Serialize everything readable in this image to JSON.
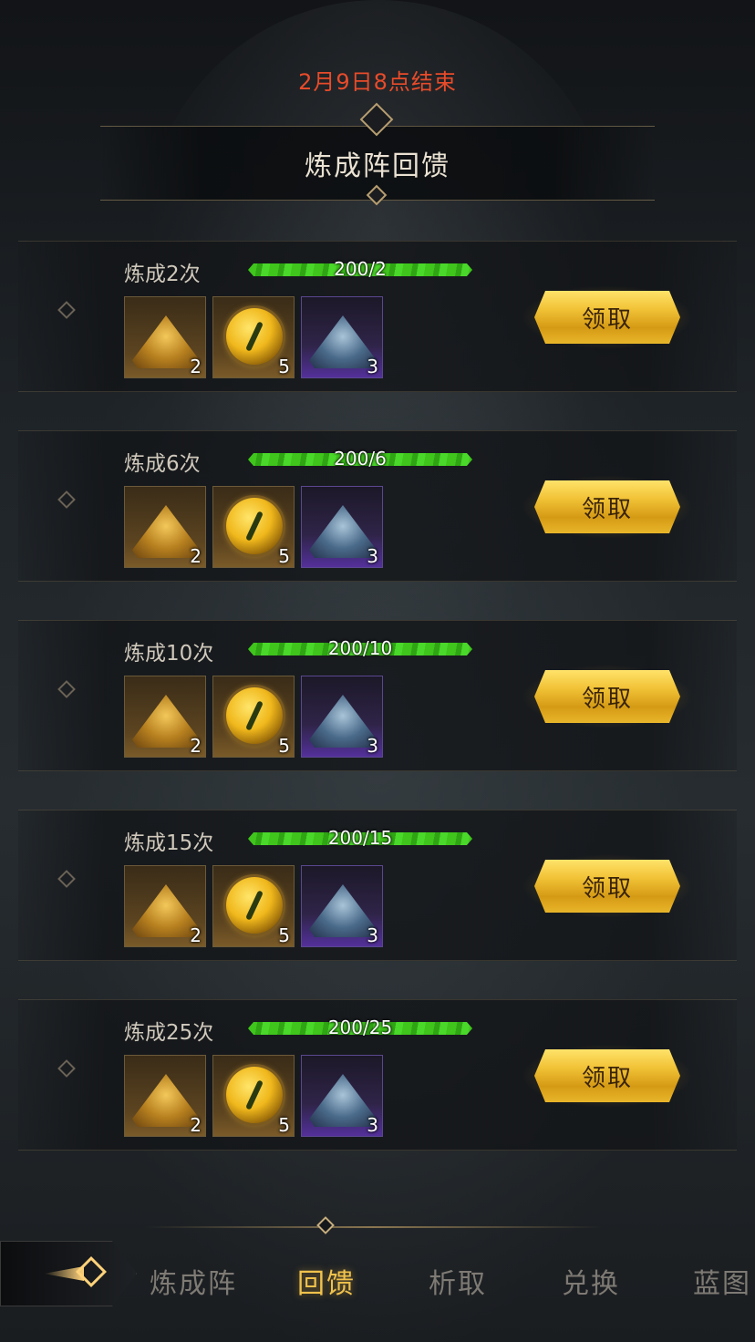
{
  "deadline": "2月9日8点结束",
  "title": "炼成阵回馈",
  "rows": [
    {
      "label": "炼成2次",
      "progress": "200/2",
      "claim": "领取",
      "items": [
        {
          "count": "2"
        },
        {
          "count": "5"
        },
        {
          "count": "3"
        }
      ]
    },
    {
      "label": "炼成6次",
      "progress": "200/6",
      "claim": "领取",
      "items": [
        {
          "count": "2"
        },
        {
          "count": "5"
        },
        {
          "count": "3"
        }
      ]
    },
    {
      "label": "炼成10次",
      "progress": "200/10",
      "claim": "领取",
      "items": [
        {
          "count": "2"
        },
        {
          "count": "5"
        },
        {
          "count": "3"
        }
      ]
    },
    {
      "label": "炼成15次",
      "progress": "200/15",
      "claim": "领取",
      "items": [
        {
          "count": "2"
        },
        {
          "count": "5"
        },
        {
          "count": "3"
        }
      ]
    },
    {
      "label": "炼成25次",
      "progress": "200/25",
      "claim": "领取",
      "items": [
        {
          "count": "2"
        },
        {
          "count": "5"
        },
        {
          "count": "3"
        }
      ]
    }
  ],
  "item_icons": [
    "gold-dust-pile-icon",
    "golden-orb-icon",
    "blue-crystal-pile-icon"
  ],
  "tabs": [
    {
      "label": "炼成阵"
    },
    {
      "label": "回馈",
      "active": true
    },
    {
      "label": "析取"
    },
    {
      "label": "兑换"
    },
    {
      "label": "蓝图"
    }
  ],
  "colors": {
    "deadline": "#e84b2a",
    "active_tab": "#f0c24c",
    "progress_bar": "#3fc51c",
    "claim_button": "#f1c236"
  }
}
